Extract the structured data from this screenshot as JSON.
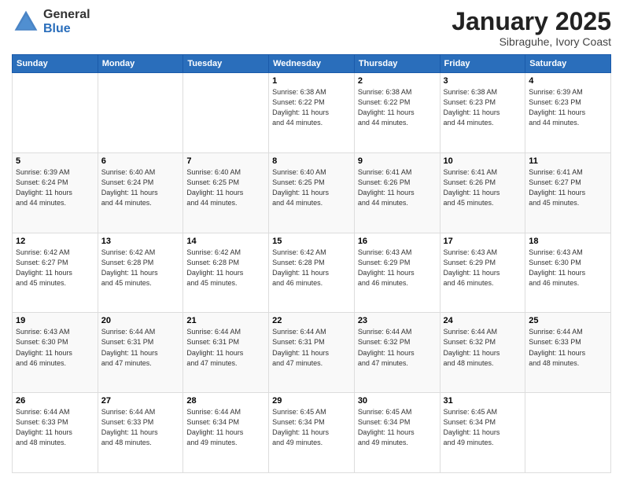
{
  "logo": {
    "general": "General",
    "blue": "Blue"
  },
  "title": {
    "month": "January 2025",
    "location": "Sibraguhe, Ivory Coast"
  },
  "days_of_week": [
    "Sunday",
    "Monday",
    "Tuesday",
    "Wednesday",
    "Thursday",
    "Friday",
    "Saturday"
  ],
  "weeks": [
    [
      {
        "day": "",
        "info": ""
      },
      {
        "day": "",
        "info": ""
      },
      {
        "day": "",
        "info": ""
      },
      {
        "day": "1",
        "info": "Sunrise: 6:38 AM\nSunset: 6:22 PM\nDaylight: 11 hours\nand 44 minutes."
      },
      {
        "day": "2",
        "info": "Sunrise: 6:38 AM\nSunset: 6:22 PM\nDaylight: 11 hours\nand 44 minutes."
      },
      {
        "day": "3",
        "info": "Sunrise: 6:38 AM\nSunset: 6:23 PM\nDaylight: 11 hours\nand 44 minutes."
      },
      {
        "day": "4",
        "info": "Sunrise: 6:39 AM\nSunset: 6:23 PM\nDaylight: 11 hours\nand 44 minutes."
      }
    ],
    [
      {
        "day": "5",
        "info": "Sunrise: 6:39 AM\nSunset: 6:24 PM\nDaylight: 11 hours\nand 44 minutes."
      },
      {
        "day": "6",
        "info": "Sunrise: 6:40 AM\nSunset: 6:24 PM\nDaylight: 11 hours\nand 44 minutes."
      },
      {
        "day": "7",
        "info": "Sunrise: 6:40 AM\nSunset: 6:25 PM\nDaylight: 11 hours\nand 44 minutes."
      },
      {
        "day": "8",
        "info": "Sunrise: 6:40 AM\nSunset: 6:25 PM\nDaylight: 11 hours\nand 44 minutes."
      },
      {
        "day": "9",
        "info": "Sunrise: 6:41 AM\nSunset: 6:26 PM\nDaylight: 11 hours\nand 44 minutes."
      },
      {
        "day": "10",
        "info": "Sunrise: 6:41 AM\nSunset: 6:26 PM\nDaylight: 11 hours\nand 45 minutes."
      },
      {
        "day": "11",
        "info": "Sunrise: 6:41 AM\nSunset: 6:27 PM\nDaylight: 11 hours\nand 45 minutes."
      }
    ],
    [
      {
        "day": "12",
        "info": "Sunrise: 6:42 AM\nSunset: 6:27 PM\nDaylight: 11 hours\nand 45 minutes."
      },
      {
        "day": "13",
        "info": "Sunrise: 6:42 AM\nSunset: 6:28 PM\nDaylight: 11 hours\nand 45 minutes."
      },
      {
        "day": "14",
        "info": "Sunrise: 6:42 AM\nSunset: 6:28 PM\nDaylight: 11 hours\nand 45 minutes."
      },
      {
        "day": "15",
        "info": "Sunrise: 6:42 AM\nSunset: 6:28 PM\nDaylight: 11 hours\nand 46 minutes."
      },
      {
        "day": "16",
        "info": "Sunrise: 6:43 AM\nSunset: 6:29 PM\nDaylight: 11 hours\nand 46 minutes."
      },
      {
        "day": "17",
        "info": "Sunrise: 6:43 AM\nSunset: 6:29 PM\nDaylight: 11 hours\nand 46 minutes."
      },
      {
        "day": "18",
        "info": "Sunrise: 6:43 AM\nSunset: 6:30 PM\nDaylight: 11 hours\nand 46 minutes."
      }
    ],
    [
      {
        "day": "19",
        "info": "Sunrise: 6:43 AM\nSunset: 6:30 PM\nDaylight: 11 hours\nand 46 minutes."
      },
      {
        "day": "20",
        "info": "Sunrise: 6:44 AM\nSunset: 6:31 PM\nDaylight: 11 hours\nand 47 minutes."
      },
      {
        "day": "21",
        "info": "Sunrise: 6:44 AM\nSunset: 6:31 PM\nDaylight: 11 hours\nand 47 minutes."
      },
      {
        "day": "22",
        "info": "Sunrise: 6:44 AM\nSunset: 6:31 PM\nDaylight: 11 hours\nand 47 minutes."
      },
      {
        "day": "23",
        "info": "Sunrise: 6:44 AM\nSunset: 6:32 PM\nDaylight: 11 hours\nand 47 minutes."
      },
      {
        "day": "24",
        "info": "Sunrise: 6:44 AM\nSunset: 6:32 PM\nDaylight: 11 hours\nand 48 minutes."
      },
      {
        "day": "25",
        "info": "Sunrise: 6:44 AM\nSunset: 6:33 PM\nDaylight: 11 hours\nand 48 minutes."
      }
    ],
    [
      {
        "day": "26",
        "info": "Sunrise: 6:44 AM\nSunset: 6:33 PM\nDaylight: 11 hours\nand 48 minutes."
      },
      {
        "day": "27",
        "info": "Sunrise: 6:44 AM\nSunset: 6:33 PM\nDaylight: 11 hours\nand 48 minutes."
      },
      {
        "day": "28",
        "info": "Sunrise: 6:44 AM\nSunset: 6:34 PM\nDaylight: 11 hours\nand 49 minutes."
      },
      {
        "day": "29",
        "info": "Sunrise: 6:45 AM\nSunset: 6:34 PM\nDaylight: 11 hours\nand 49 minutes."
      },
      {
        "day": "30",
        "info": "Sunrise: 6:45 AM\nSunset: 6:34 PM\nDaylight: 11 hours\nand 49 minutes."
      },
      {
        "day": "31",
        "info": "Sunrise: 6:45 AM\nSunset: 6:34 PM\nDaylight: 11 hours\nand 49 minutes."
      },
      {
        "day": "",
        "info": ""
      }
    ]
  ]
}
